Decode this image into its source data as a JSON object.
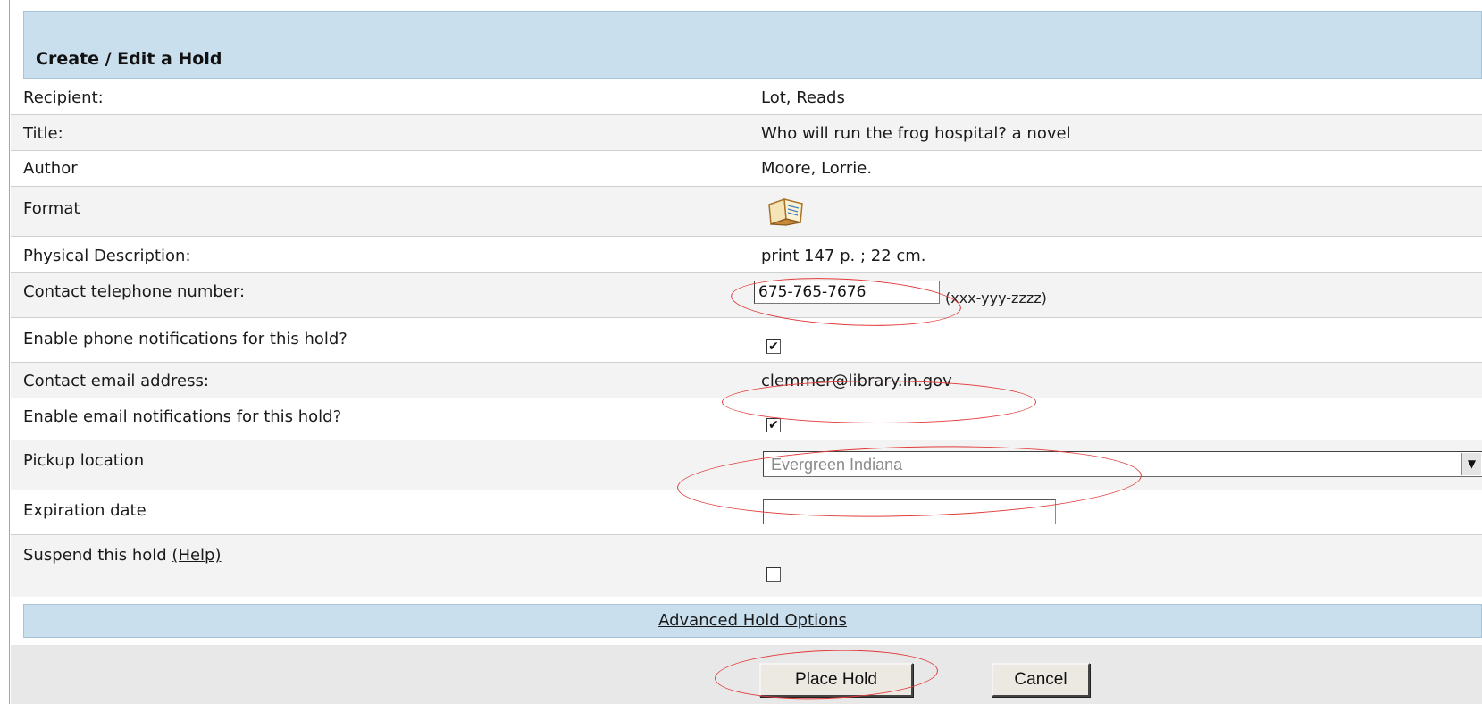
{
  "header": {
    "title": "Create / Edit a Hold"
  },
  "rows": {
    "recipient": {
      "label": "Recipient:",
      "value": "Lot, Reads"
    },
    "title": {
      "label": "Title:",
      "value": "Who will run the frog hospital? a novel"
    },
    "author": {
      "label": "Author",
      "value": "Moore, Lorrie."
    },
    "format": {
      "label": "Format",
      "icon": "book-icon"
    },
    "physical": {
      "label": "Physical Description:",
      "value": "print 147 p. ; 22 cm."
    },
    "phone": {
      "label": "Contact telephone number:",
      "value": "675-765-7676",
      "hint": "(xxx-yyy-zzzz)"
    },
    "phone_notify": {
      "label": "Enable phone notifications for this hold?",
      "checked": true,
      "mark": "✔"
    },
    "email": {
      "label": "Contact email address:",
      "value": "clemmer@library.in.gov"
    },
    "email_notify": {
      "label": "Enable email notifications for this hold?",
      "checked": true,
      "mark": "✔"
    },
    "pickup": {
      "label": "Pickup location",
      "selected": "Evergreen Indiana"
    },
    "expiration": {
      "label": "Expiration date",
      "value": ""
    },
    "suspend": {
      "label": "Suspend this hold",
      "help": "(Help)",
      "checked": false
    }
  },
  "advanced": {
    "label": "Advanced Hold Options"
  },
  "buttons": {
    "place_hold": "Place Hold",
    "cancel": "Cancel"
  },
  "colors": {
    "header_bg": "#c9dfee",
    "annotation": "#e23a3a",
    "row_alt": "#f3f3f3"
  }
}
